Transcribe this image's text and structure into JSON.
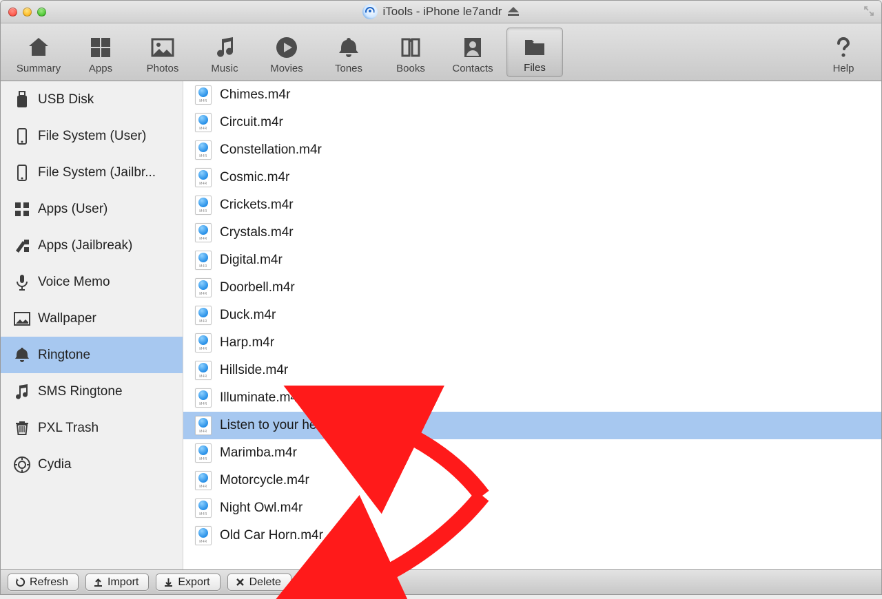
{
  "window": {
    "title": "iTools - iPhone le7andr"
  },
  "toolbar": {
    "items": [
      {
        "key": "summary",
        "label": "Summary"
      },
      {
        "key": "apps",
        "label": "Apps"
      },
      {
        "key": "photos",
        "label": "Photos"
      },
      {
        "key": "music",
        "label": "Music"
      },
      {
        "key": "movies",
        "label": "Movies"
      },
      {
        "key": "tones",
        "label": "Tones"
      },
      {
        "key": "books",
        "label": "Books"
      },
      {
        "key": "contacts",
        "label": "Contacts"
      },
      {
        "key": "files",
        "label": "Files"
      }
    ],
    "help_label": "Help",
    "selected": "files"
  },
  "sidebar": {
    "items": [
      {
        "key": "usb-disk",
        "label": "USB Disk"
      },
      {
        "key": "fs-user",
        "label": "File System (User)"
      },
      {
        "key": "fs-jailbreak",
        "label": "File System (Jailbr..."
      },
      {
        "key": "apps-user",
        "label": "Apps (User)"
      },
      {
        "key": "apps-jb",
        "label": "Apps (Jailbreak)"
      },
      {
        "key": "voice-memo",
        "label": "Voice Memo"
      },
      {
        "key": "wallpaper",
        "label": "Wallpaper"
      },
      {
        "key": "ringtone",
        "label": "Ringtone"
      },
      {
        "key": "sms-ringtone",
        "label": "SMS Ringtone"
      },
      {
        "key": "pxl-trash",
        "label": "PXL Trash"
      },
      {
        "key": "cydia",
        "label": "Cydia"
      }
    ],
    "selected": "ringtone"
  },
  "files": {
    "selected_index": 12,
    "rows": [
      "Chimes.m4r",
      "Circuit.m4r",
      "Constellation.m4r",
      "Cosmic.m4r",
      "Crickets.m4r",
      "Crystals.m4r",
      "Digital.m4r",
      "Doorbell.m4r",
      "Duck.m4r",
      "Harp.m4r",
      "Hillside.m4r",
      "Illuminate.m4r",
      "Listen to your heart.m4r",
      "Marimba.m4r",
      "Motorcycle.m4r",
      "Night Owl.m4r",
      "Old Car Horn.m4r"
    ]
  },
  "bottombar": {
    "refresh": "Refresh",
    "import": "Import",
    "export": "Export",
    "delete": "Delete"
  }
}
